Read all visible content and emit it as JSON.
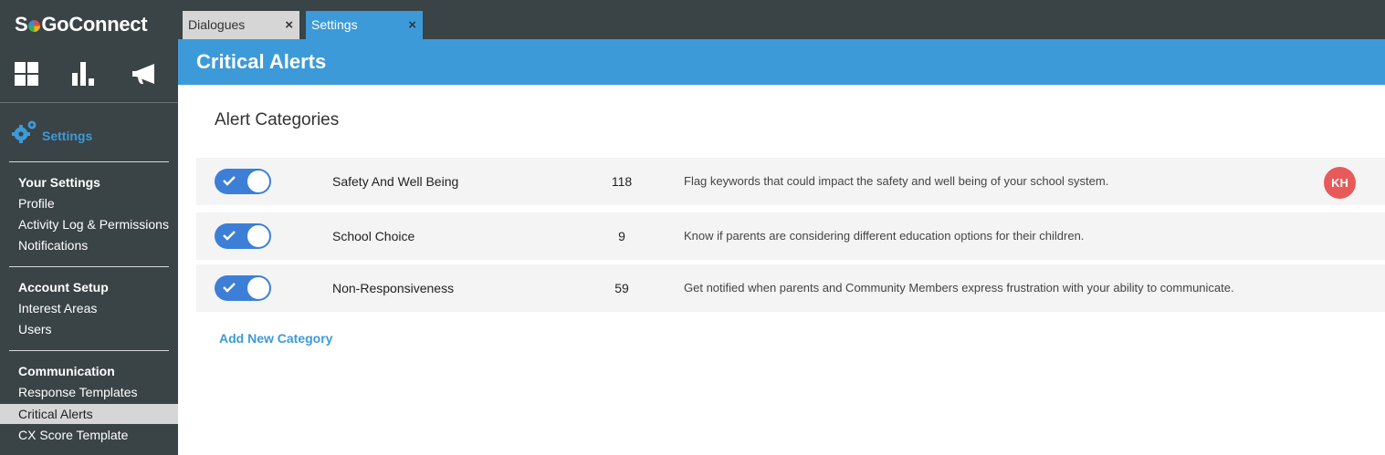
{
  "app": {
    "logo_prefix": "S",
    "logo_suffix": "GoConnect"
  },
  "tabs": [
    {
      "label": "Dialogues",
      "close": "×"
    },
    {
      "label": "Settings",
      "close": "×"
    }
  ],
  "icons": {
    "top": [
      "dashboard-grid-icon",
      "bar-chart-icon",
      "megaphone-icon"
    ],
    "settings": "gears-icon",
    "toggle_check": "check-icon"
  },
  "sidebar": {
    "settings_label": "Settings",
    "sections": [
      {
        "title": "Your Settings",
        "items": [
          "Profile",
          "Activity Log & Permissions",
          "Notifications"
        ]
      },
      {
        "title": "Account Setup",
        "items": [
          "Interest Areas",
          "Users"
        ]
      },
      {
        "title": "Communication",
        "items": [
          "Response Templates",
          "Critical Alerts",
          "CX Score Template"
        ]
      }
    ],
    "active_item": "Critical Alerts"
  },
  "header": {
    "title": "Critical Alerts"
  },
  "main": {
    "title": "Alert Categories",
    "add_label": "Add New Category",
    "rows": [
      {
        "enabled": true,
        "name": "Safety And Well Being",
        "count": "118",
        "description": "Flag keywords that could impact the safety and well being of your school system.",
        "avatar": "KH"
      },
      {
        "enabled": true,
        "name": "School Choice",
        "count": "9",
        "description": "Know if parents are considering different education options for their children.",
        "avatar": ""
      },
      {
        "enabled": true,
        "name": "Non-Responsiveness",
        "count": "59",
        "description": "Get notified when parents and Community Members express frustration with your ability to communicate.",
        "avatar": ""
      }
    ]
  },
  "colors": {
    "accent": "#3d9ad8",
    "sidebar_bg": "#3a4345",
    "toggle_on": "#3d7fd6",
    "avatar_bg": "#e85a5a"
  }
}
